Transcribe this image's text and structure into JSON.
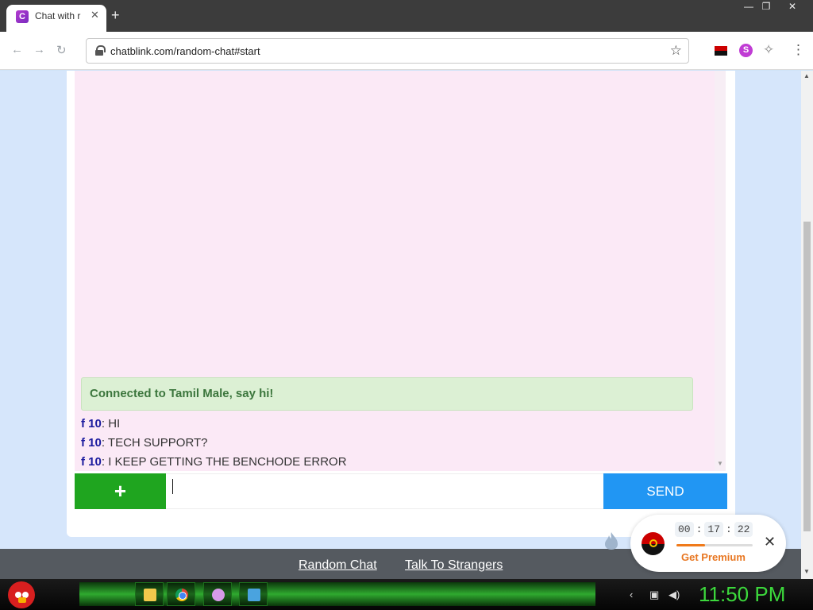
{
  "browser": {
    "tab_title": "Chat with r",
    "tab_favicon_letter": "C",
    "new_tab_icon": "plus-icon",
    "url": "chatblink.com/random-chat#start",
    "window_controls": {
      "minimize": "—",
      "restore": "❐",
      "close": "✕"
    },
    "nav": {
      "back": "←",
      "forward": "→",
      "reload": "↻"
    },
    "extension_s_letter": "S"
  },
  "chat": {
    "connected_message": "Connected to Tamil Male, say hi!",
    "messages": [
      {
        "author": "f 10",
        "text": ": HI"
      },
      {
        "author": "f 10",
        "text": ": TECH SUPPORT?"
      },
      {
        "author": "f 10",
        "text": ": I KEEP GETTING THE BENCHODE ERROR"
      }
    ],
    "plus_label": "+",
    "input_value": "",
    "send_label": "SEND"
  },
  "footer": {
    "links": [
      "Random Chat",
      "Talk To Strangers"
    ]
  },
  "premium": {
    "timer": {
      "hours": "00",
      "minutes": "17",
      "seconds": "22"
    },
    "progress_fraction": 0.37,
    "label": "Get Premium",
    "close": "✕"
  },
  "taskbar": {
    "clock": "11:50 PM"
  },
  "colors": {
    "send": "#2196f3",
    "plus": "#1fa51f",
    "connected_bg": "#dcf0d4",
    "premium_accent": "#e87722",
    "clock": "#3cd83c"
  }
}
